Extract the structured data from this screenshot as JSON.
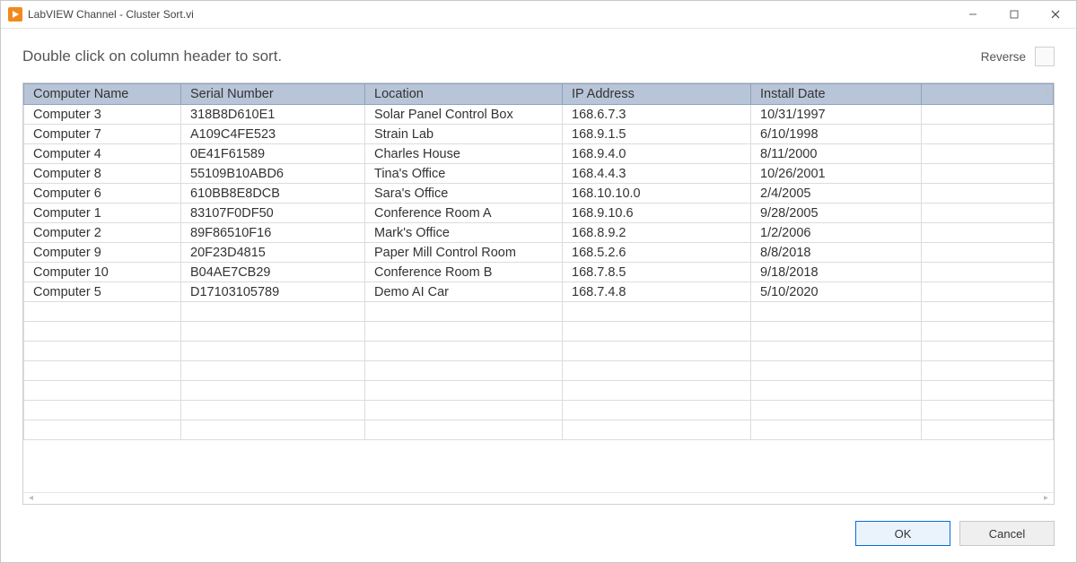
{
  "window": {
    "title": "LabVIEW Channel - Cluster Sort.vi"
  },
  "hint": "Double click on column header to sort.",
  "reverse": {
    "label": "Reverse",
    "checked": false
  },
  "columns": [
    "Computer Name",
    "Serial Number",
    "Location",
    "IP Address",
    "Install Date"
  ],
  "rows": [
    {
      "name": "Computer 3",
      "serial": "318B8D610E1",
      "location": "Solar Panel Control Box",
      "ip": "168.6.7.3",
      "date": "10/31/1997"
    },
    {
      "name": "Computer 7",
      "serial": "A109C4FE523",
      "location": "Strain Lab",
      "ip": "168.9.1.5",
      "date": "6/10/1998"
    },
    {
      "name": "Computer 4",
      "serial": "0E41F61589",
      "location": "Charles House",
      "ip": "168.9.4.0",
      "date": "8/11/2000"
    },
    {
      "name": "Computer 8",
      "serial": "55109B10ABD6",
      "location": "Tina's Office",
      "ip": "168.4.4.3",
      "date": "10/26/2001"
    },
    {
      "name": "Computer 6",
      "serial": "610BB8E8DCB",
      "location": "Sara's Office",
      "ip": "168.10.10.0",
      "date": "2/4/2005"
    },
    {
      "name": "Computer 1",
      "serial": "83107F0DF50",
      "location": "Conference Room A",
      "ip": "168.9.10.6",
      "date": "9/28/2005"
    },
    {
      "name": "Computer 2",
      "serial": "89F86510F16",
      "location": "Mark's Office",
      "ip": "168.8.9.2",
      "date": "1/2/2006"
    },
    {
      "name": "Computer 9",
      "serial": "20F23D4815",
      "location": "Paper Mill Control Room",
      "ip": "168.5.2.6",
      "date": "8/8/2018"
    },
    {
      "name": "Computer 10",
      "serial": "B04AE7CB29",
      "location": "Conference Room B",
      "ip": "168.7.8.5",
      "date": "9/18/2018"
    },
    {
      "name": "Computer 5",
      "serial": "D17103105789",
      "location": "Demo AI Car",
      "ip": "168.7.4.8",
      "date": "5/10/2020"
    }
  ],
  "empty_row_count": 7,
  "buttons": {
    "ok": "OK",
    "cancel": "Cancel"
  },
  "colors": {
    "header_bg": "#b8c5d9",
    "header_border": "#8ea2bd",
    "accent": "#0a6cd6",
    "labview_orange": "#f18a1c"
  }
}
